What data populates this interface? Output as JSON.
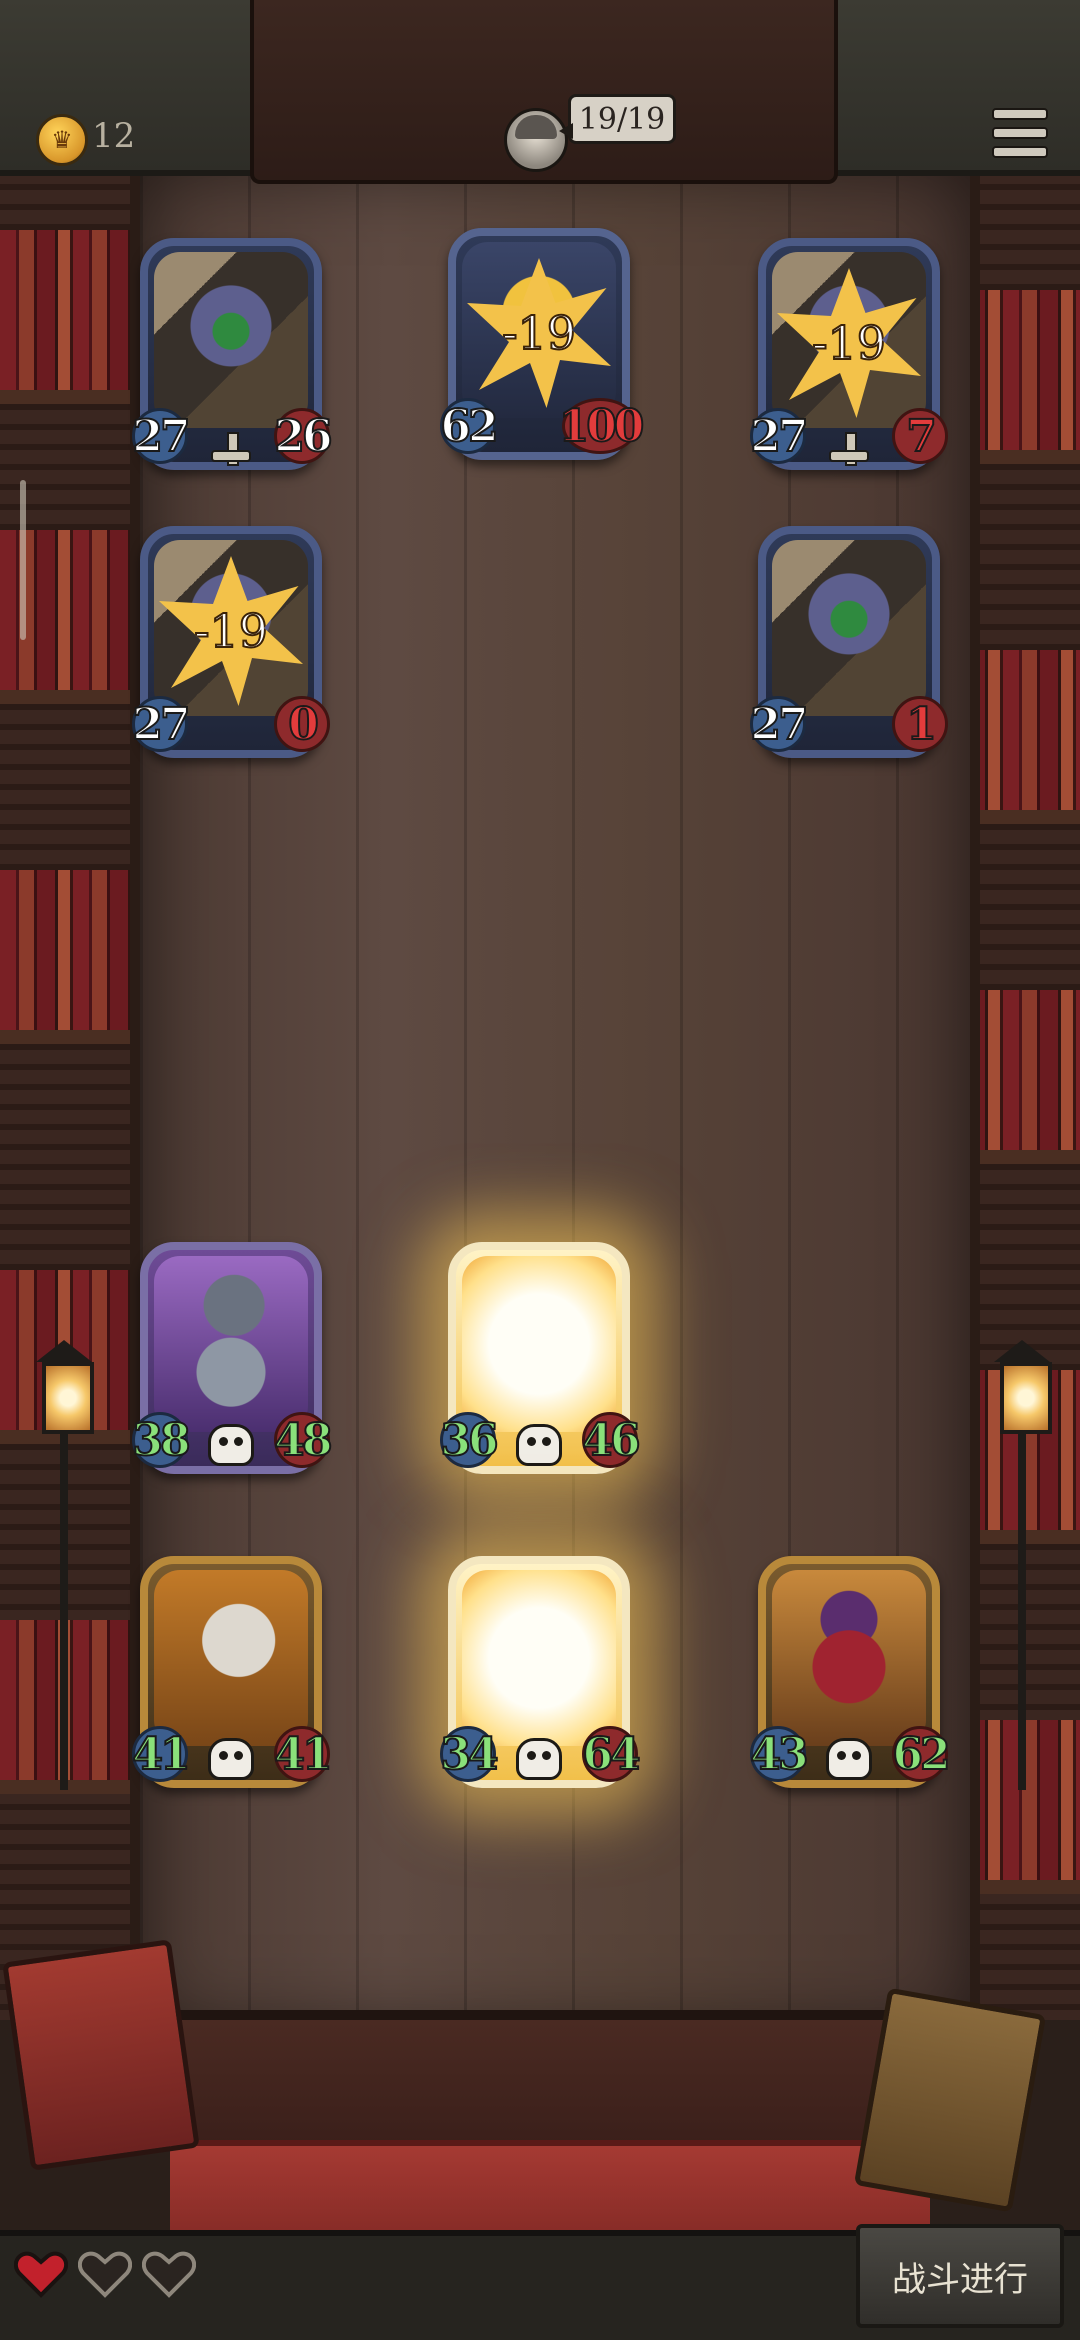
{
  "hud": {
    "coins": "12",
    "player_hp": "19/19"
  },
  "enemies": [
    {
      "id": "enemy-1",
      "attack": "27",
      "health": "26",
      "damage": null,
      "health_critical": false
    },
    {
      "id": "boss",
      "attack": "62",
      "health": "100",
      "damage": "-19",
      "health_critical": true
    },
    {
      "id": "enemy-3",
      "attack": "27",
      "health": "7",
      "damage": "-19",
      "health_critical": true
    },
    {
      "id": "enemy-4",
      "attack": "27",
      "health": "0",
      "damage": "-19",
      "health_critical": true
    },
    {
      "id": "enemy-5",
      "attack": "27",
      "health": "1",
      "damage": null,
      "health_critical": true
    }
  ],
  "allies": [
    {
      "id": "robot",
      "attack": "38",
      "health": "48"
    },
    {
      "id": "glow-1",
      "attack": "36",
      "health": "46"
    },
    {
      "id": "chef",
      "attack": "41",
      "health": "41"
    },
    {
      "id": "glow-2",
      "attack": "34",
      "health": "64"
    },
    {
      "id": "jester",
      "attack": "43",
      "health": "62"
    }
  ],
  "lives": {
    "total": 3
  },
  "battle_button": "战斗进行",
  "colors": {
    "attack_badge": "#3c5e8e",
    "health_badge": "#8e2a2c",
    "ally_stat_text": "#8ae07a",
    "damage_star": "#f3c24a"
  }
}
